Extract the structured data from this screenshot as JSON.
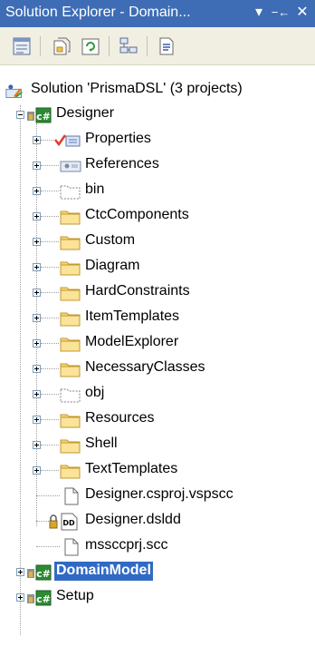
{
  "window": {
    "title": "Solution Explorer - Domain...",
    "pin_glyph": "▾",
    "autohide_glyph": "−←",
    "close_glyph": "✕"
  },
  "toolbar": {
    "buttons": [
      "properties-icon",
      "show-all-files-icon",
      "refresh-icon",
      "class-diagram-icon",
      "view-code-icon"
    ]
  },
  "tree": {
    "solution": "Solution 'PrismaDSL' (3 projects)",
    "designer": {
      "label": "Designer",
      "items": [
        {
          "label": "Properties",
          "icon": "properties-folder-icon"
        },
        {
          "label": "References",
          "icon": "references-icon"
        },
        {
          "label": "bin",
          "icon": "dotted-folder-icon"
        },
        {
          "label": "CtcComponents",
          "icon": "folder-icon"
        },
        {
          "label": "Custom",
          "icon": "folder-icon"
        },
        {
          "label": "Diagram",
          "icon": "folder-icon"
        },
        {
          "label": "HardConstraints",
          "icon": "folder-icon"
        },
        {
          "label": "ItemTemplates",
          "icon": "folder-icon"
        },
        {
          "label": "ModelExplorer",
          "icon": "folder-icon"
        },
        {
          "label": "NecessaryClasses",
          "icon": "folder-icon"
        },
        {
          "label": "obj",
          "icon": "dotted-folder-icon"
        },
        {
          "label": "Resources",
          "icon": "folder-icon"
        },
        {
          "label": "Shell",
          "icon": "folder-icon"
        },
        {
          "label": "TextTemplates",
          "icon": "folder-icon"
        },
        {
          "label": "Designer.csproj.vspscc",
          "icon": "file-icon"
        },
        {
          "label": "Designer.dsldd",
          "icon": "dd-file-icon"
        },
        {
          "label": "mssccprj.scc",
          "icon": "file-icon"
        }
      ]
    },
    "domainmodel": {
      "label": "DomainModel"
    },
    "setup": {
      "label": "Setup"
    }
  }
}
